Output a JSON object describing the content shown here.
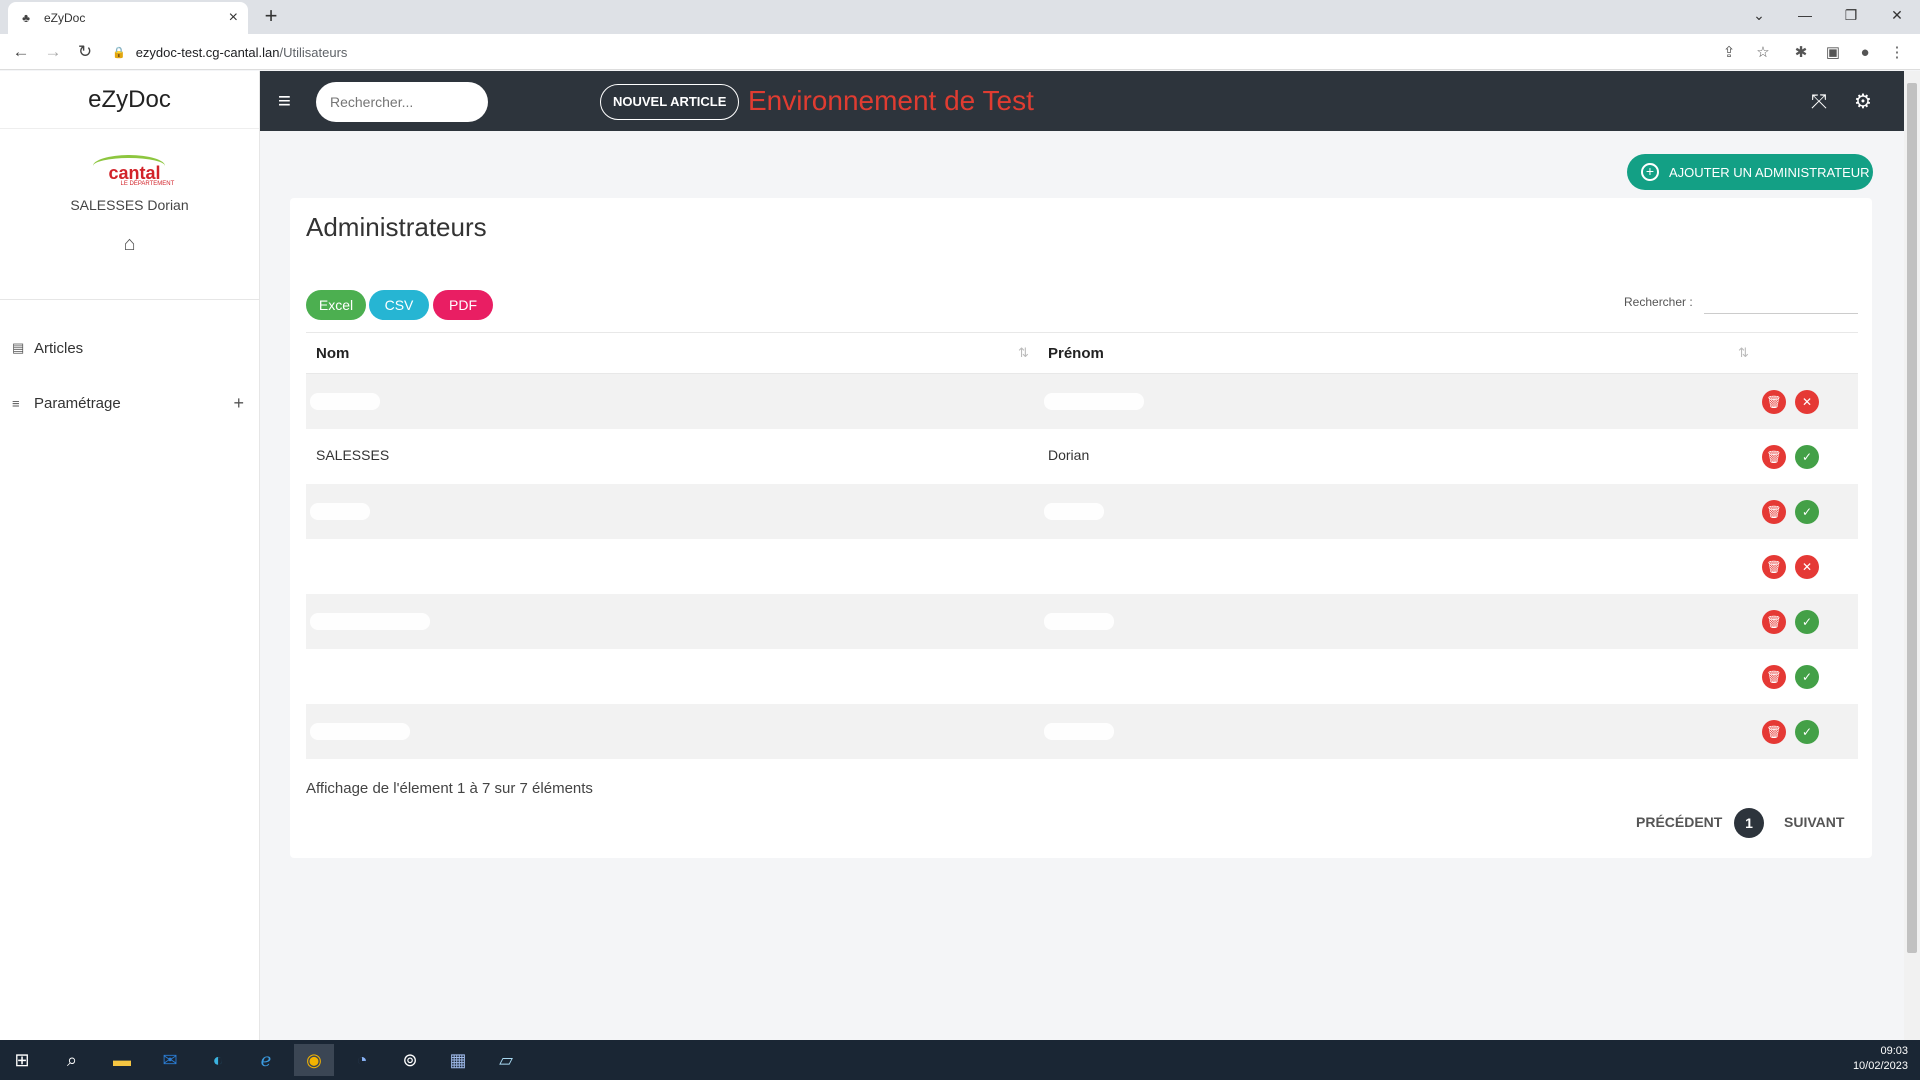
{
  "browser": {
    "tab_title": "eZyDoc",
    "url_host": "ezydoc-test.cg-cantal.lan",
    "url_path": "/Utilisateurs"
  },
  "sidebar": {
    "brand": "eZyDoc",
    "logo_text": "cantal",
    "logo_sub": "LE DÉPARTEMENT",
    "user_name": "SALESSES Dorian",
    "items": [
      {
        "label": "Articles",
        "icon": "document-icon"
      },
      {
        "label": "Paramétrage",
        "icon": "list-icon",
        "expand": "+"
      }
    ]
  },
  "appbar": {
    "search_placeholder": "Rechercher...",
    "new_article_label": "NOUVEL ARTICLE",
    "env_title": "Environnement de Test",
    "env_color": "#e03c31"
  },
  "main": {
    "add_admin_label": "AJOUTER UN ADMINISTRATEUR",
    "title": "Administrateurs",
    "export_buttons": [
      {
        "label": "Excel",
        "color": "#4caf50"
      },
      {
        "label": "CSV",
        "color": "#26b5d3"
      },
      {
        "label": "PDF",
        "color": "#e91e63"
      }
    ],
    "search_label": "Rechercher :",
    "columns": [
      "Nom",
      "Prénom"
    ],
    "rows": [
      {
        "nom": "",
        "prenom": "",
        "status": "inactive"
      },
      {
        "nom": "SALESSES",
        "prenom": "Dorian",
        "status": "active"
      },
      {
        "nom": "",
        "prenom": "",
        "status": "active"
      },
      {
        "nom": "",
        "prenom": "",
        "status": "inactive"
      },
      {
        "nom": "",
        "prenom": "",
        "status": "active"
      },
      {
        "nom": "",
        "prenom": "",
        "status": "active"
      },
      {
        "nom": "",
        "prenom": "",
        "status": "active"
      }
    ],
    "info": "Affichage de l'élement 1 à 7 sur 7 éléments",
    "pagination": {
      "prev": "PRÉCÉDENT",
      "current": "1",
      "next": "SUIVANT"
    }
  },
  "taskbar": {
    "time": "09:03",
    "date": "10/02/2023"
  }
}
